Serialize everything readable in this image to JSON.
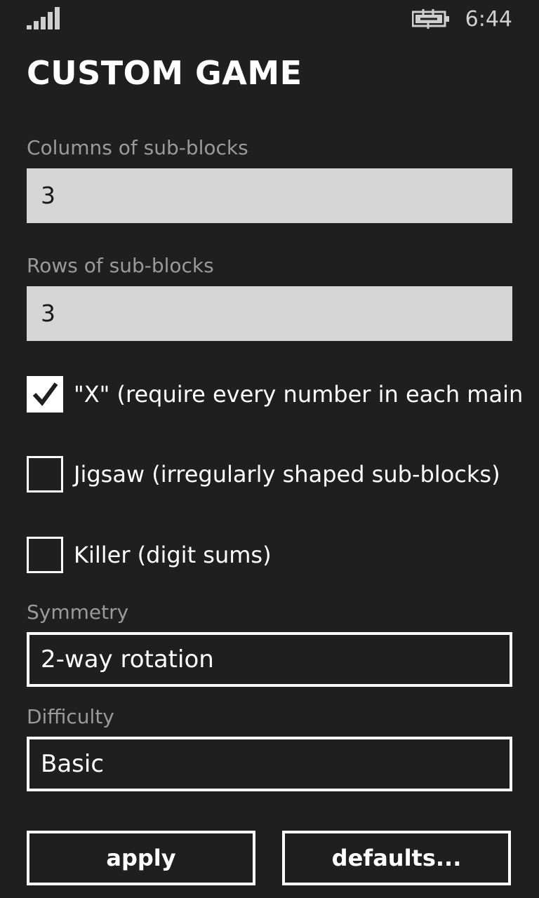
{
  "status_bar": {
    "time": "6:44",
    "signal_icon": "signal-strength-icon",
    "battery_icon": "battery-charging-icon"
  },
  "page": {
    "title": "CUSTOM GAME"
  },
  "columns": {
    "label": "Columns of sub-blocks",
    "value": "3"
  },
  "rows": {
    "label": "Rows of sub-blocks",
    "value": "3"
  },
  "options": [
    {
      "label": "\"X\" (require every number in each main",
      "checked": true
    },
    {
      "label": "Jigsaw (irregularly shaped sub-blocks)",
      "checked": false
    },
    {
      "label": "Killer (digit sums)",
      "checked": false
    }
  ],
  "symmetry": {
    "label": "Symmetry",
    "value": "2-way rotation"
  },
  "difficulty": {
    "label": "Difficulty",
    "value": "Basic"
  },
  "buttons": {
    "apply": "apply",
    "defaults": "defaults..."
  },
  "colors": {
    "background": "#1f1f1f",
    "textbox": "#d6d6d6",
    "label": "#9a9a9a",
    "foreground": "#ffffff"
  }
}
